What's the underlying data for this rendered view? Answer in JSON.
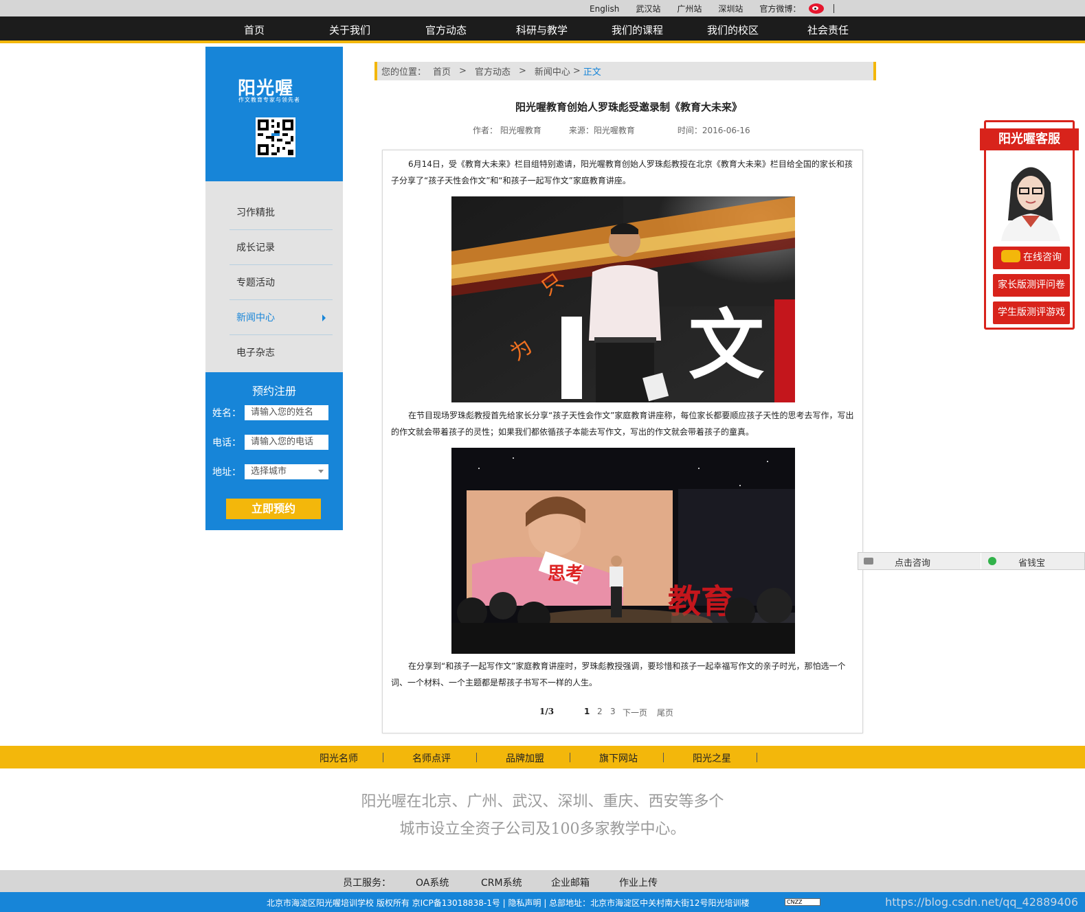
{
  "topbar": {
    "links": [
      "English",
      "武汉站",
      "广州站",
      "深圳站",
      "官方微博："
    ],
    "weibo_icon": "weibo-icon"
  },
  "nav": [
    "首页",
    "关于我们",
    "官方动态",
    "科研与教学",
    "我们的课程",
    "我们的校区",
    "社会责任"
  ],
  "brand": {
    "logo": "阳光喔",
    "slogan": "作文教育专家与领先者",
    "qr_icon": "qr-code-icon"
  },
  "submenu": [
    "习作精批",
    "成长记录",
    "专题活动",
    "新闻中心",
    "电子杂志"
  ],
  "booking": {
    "title": "预约注册",
    "name_label": "姓名：",
    "name_placeholder": "请输入您的姓名",
    "phone_label": "电话：",
    "phone_placeholder": "请输入您的电话",
    "addr_label": "地址：",
    "addr_value": "选择城市",
    "submit": "立即预约"
  },
  "breadcrumb": {
    "prefix": "您的位置：",
    "items": [
      "首页",
      "官方动态",
      "新闻中心"
    ],
    "current": "正文"
  },
  "article": {
    "title": "阳光喔教育创始人罗珠彪受邀录制《教育大未来》",
    "author": "作者：  阳光喔教育",
    "source": "来源：阳光喔教育",
    "time": "时间：2016-06-16",
    "p1": "6月14日，受《教育大未来》栏目组特别邀请，阳光喔教育创始人罗珠彪教授在北京《教育大未来》栏目给全国的家长和孩子分享了“孩子天性会作文”和“和孩子一起写作文”家庭教育讲座。",
    "p2": "在节目现场罗珠彪教授首先给家长分享“孩子天性会作文”家庭教育讲座称，每位家长都要顺应孩子天性的思考去写作，写出的作文就会带着孩子的灵性；如果我们都依循孩子本能去写作文，写出的作文就会带着孩子的童真。",
    "p3": "在分享到“和孩子一起写作文”家庭教育讲座时，罗珠彪教授强调，要珍惜和孩子一起幸福写作文的亲子时光，那怕选一个词、一个材料、一个主题都是帮孩子书写不一样的人生。",
    "photo1_text": [
      "只",
      "为",
      "文"
    ],
    "photo2_text": [
      "思考",
      "教育"
    ]
  },
  "pager": {
    "fraction": "1/3",
    "pages": [
      "1",
      "2",
      "3"
    ],
    "next": "下一页",
    "last": "尾页"
  },
  "service": {
    "title": "阳光喔客服",
    "btn_consult": "在线咨询",
    "btn_parent": "家长版测评问卷",
    "btn_student": "学生版测评游戏"
  },
  "chatbar": {
    "consult": "点击咨询",
    "save": "省钱宝"
  },
  "footer_links": [
    "阳光名师",
    "名师点评",
    "品牌加盟",
    "旗下网站",
    "阳光之星"
  ],
  "slogan": [
    "阳光喔在北京、广州、武汉、深圳、重庆、西安等多个",
    "城市设立全资子公司及100多家教学中心。"
  ],
  "staff": {
    "label": "员工服务：",
    "links": [
      "OA系统",
      "CRM系统",
      "企业邮箱",
      "作业上传"
    ]
  },
  "copyright": "北京市海淀区阳光喔培训学校  版权所有  京ICP备13018838-1号   |  隐私声明   |  总部地址：北京市海淀区中关村南大街12号阳光培训楼",
  "cnzz": "CNZZ",
  "watermark": "https://blog.csdn.net/qq_42889406",
  "colors": {
    "brand_blue": "#1785d8",
    "accent_yellow": "#f3b70b",
    "service_red": "#d8231b",
    "nav_black": "#1c1c1c"
  }
}
